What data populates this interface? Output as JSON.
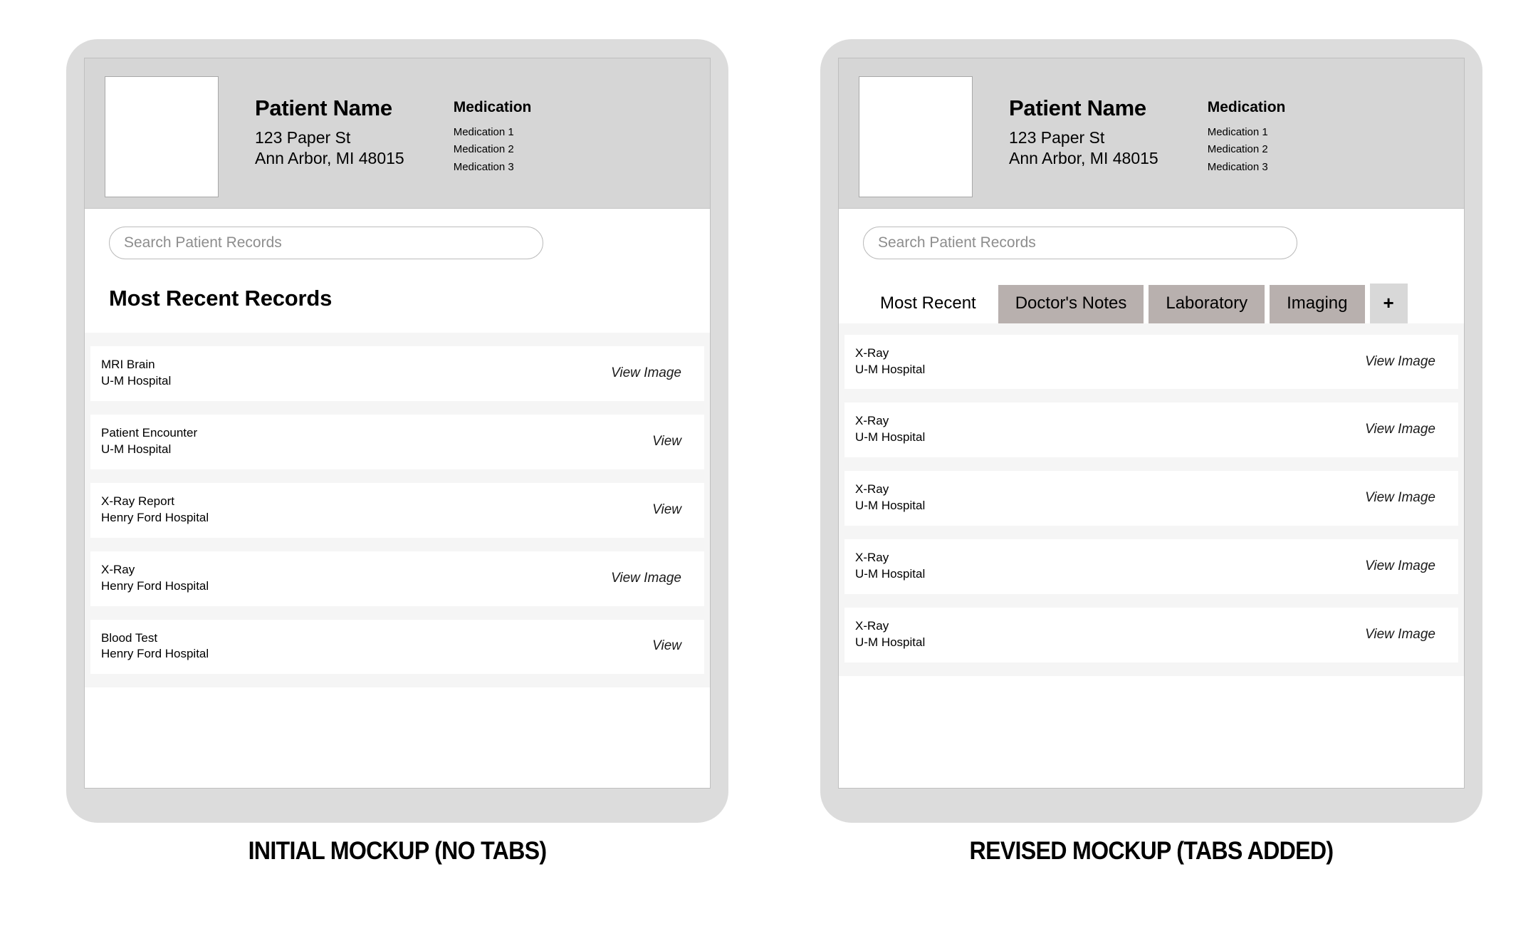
{
  "panels": [
    {
      "caption": "INITIAL MOCKUP (NO TABS)",
      "patient": {
        "name": "Patient Name",
        "address_line1": "123 Paper St",
        "address_line2": "Ann Arbor, MI 48015",
        "medication_title": "Medication",
        "medications": [
          "Medication 1",
          "Medication 2",
          "Medication 3"
        ]
      },
      "search": {
        "value": "",
        "placeholder": "Search Patient Records"
      },
      "section_title": "Most Recent Records",
      "has_tabs": false,
      "records": [
        {
          "title": "MRI Brain",
          "source": "U-M Hospital",
          "action": "View Image"
        },
        {
          "title": "Patient Encounter",
          "source": "U-M Hospital",
          "action": "View"
        },
        {
          "title": "X-Ray Report",
          "source": "Henry Ford Hospital",
          "action": "View"
        },
        {
          "title": "X-Ray",
          "source": "Henry Ford Hospital",
          "action": "View Image"
        },
        {
          "title": "Blood Test",
          "source": "Henry Ford Hospital",
          "action": "View"
        }
      ]
    },
    {
      "caption": "REVISED MOCKUP (TABS ADDED)",
      "patient": {
        "name": "Patient Name",
        "address_line1": "123 Paper St",
        "address_line2": "Ann Arbor, MI 48015",
        "medication_title": "Medication",
        "medications": [
          "Medication 1",
          "Medication 2",
          "Medication 3"
        ]
      },
      "search": {
        "value": "",
        "placeholder": "Search Patient Records"
      },
      "has_tabs": true,
      "tabs": [
        {
          "label": "Most Recent",
          "state": "active"
        },
        {
          "label": "Doctor's Notes",
          "state": "inactive"
        },
        {
          "label": "Laboratory",
          "state": "inactive"
        },
        {
          "label": "Imaging",
          "state": "inactive"
        },
        {
          "label": "+",
          "state": "add"
        }
      ],
      "records": [
        {
          "title": "X-Ray",
          "source": "U-M Hospital",
          "action": "View Image"
        },
        {
          "title": "X-Ray",
          "source": "U-M Hospital",
          "action": "View Image"
        },
        {
          "title": "X-Ray",
          "source": "U-M Hospital",
          "action": "View Image"
        },
        {
          "title": "X-Ray",
          "source": "U-M Hospital",
          "action": "View Image"
        },
        {
          "title": "X-Ray",
          "source": "U-M Hospital",
          "action": "View Image"
        }
      ]
    }
  ],
  "colors": {
    "bezel": "#dcdcdc",
    "header_gray": "#d6d6d6",
    "list_track": "#f5f5f5",
    "tab_inactive": "#b8b0ae",
    "tab_add": "#d8d8d8"
  }
}
